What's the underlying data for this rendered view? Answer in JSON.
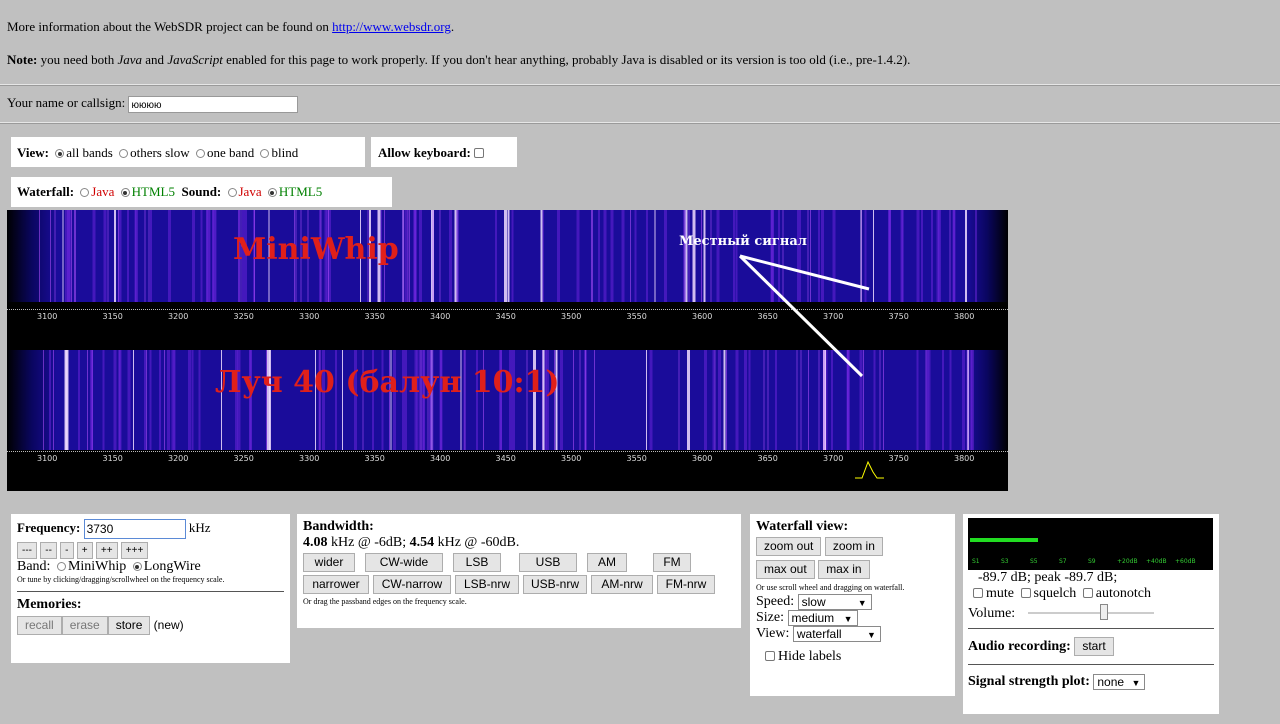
{
  "intro": {
    "text": "More information about the WebSDR project can be found on ",
    "link": "http://www.websdr.org",
    "period": "."
  },
  "note": {
    "label": "Note:",
    "t1": " you need both ",
    "java": "Java",
    "t2": " and ",
    "javascript": "JavaScript",
    "t3": " enabled for this page to work properly. If you don't hear anything, probably Java is disabled or its version is too old (i.e., pre-1.4.2)."
  },
  "callsign": {
    "label": "Your name or callsign:",
    "value": "юююю"
  },
  "view": {
    "label": "View:",
    "options": [
      "all bands",
      "others slow",
      "one band",
      "blind"
    ],
    "selected": 0
  },
  "keyboard": {
    "label": "Allow keyboard:"
  },
  "waterfall_mode": {
    "label": "Waterfall:",
    "java": "Java",
    "html5": "HTML5"
  },
  "sound_mode": {
    "label": "Sound:",
    "java": "Java",
    "html5": "HTML5"
  },
  "waterfall": {
    "band1_label": "MiniWhip",
    "band2_label": "Луч 40 (балун 10:1)",
    "annotation": "Местный сигнал",
    "ticks": [
      "3100",
      "3150",
      "3200",
      "3250",
      "3300",
      "3350",
      "3400",
      "3450",
      "3500",
      "3550",
      "3600",
      "3650",
      "3700",
      "3750",
      "3800"
    ]
  },
  "frequency": {
    "label": "Frequency:",
    "value": "3730",
    "unit": "kHz",
    "steps": [
      "---",
      "--",
      "-",
      "+",
      "++",
      "+++"
    ],
    "band_label": "Band:",
    "bands": [
      "MiniWhip",
      "LongWire"
    ],
    "hint": "Or tune by clicking/dragging/scrollwheel on the frequency scale."
  },
  "memories": {
    "label": "Memories:",
    "recall": "recall",
    "erase": "erase",
    "store": "store",
    "status": "(new)"
  },
  "bandwidth": {
    "label": "Bandwidth:",
    "v1": "4.08",
    "t1": " kHz @ -6dB; ",
    "v2": "4.54",
    "t2": " kHz @ -60dB.",
    "row1": [
      "wider",
      "CW-wide",
      "LSB",
      "USB",
      "AM",
      "FM"
    ],
    "row2": [
      "narrower",
      "CW-narrow",
      "LSB-nrw",
      "USB-nrw",
      "AM-nrw",
      "FM-nrw"
    ],
    "hint": "Or drag the passband edges on the frequency scale."
  },
  "wfview": {
    "label": "Waterfall view:",
    "zoom_out": "zoom out",
    "zoom_in": "zoom in",
    "max_out": "max out",
    "max_in": "max in",
    "hint": "Or use scroll wheel and dragging on waterfall.",
    "speed_label": "Speed:",
    "speed": "slow",
    "size_label": "Size:",
    "size": "medium",
    "view_label": "View:",
    "view": "waterfall",
    "hide_labels": "Hide labels"
  },
  "audio": {
    "smeter_ticks": [
      "S1",
      "S3",
      "S5",
      "S7",
      "S9",
      "+20dB",
      "+40dB",
      "+60dB"
    ],
    "level_text": "-89.7 dB; peak  -89.7 dB;",
    "mute": "mute",
    "squelch": "squelch",
    "autonotch": "autonotch",
    "volume_label": "Volume:",
    "volume_level": 0.6,
    "recording_label": "Audio recording:",
    "start": "start",
    "plot_label": "Signal strength plot:",
    "plot": "none"
  },
  "colors": {
    "accent_red": "#e0201a",
    "green": "#008000",
    "smeter_bar": "#22dd22"
  }
}
